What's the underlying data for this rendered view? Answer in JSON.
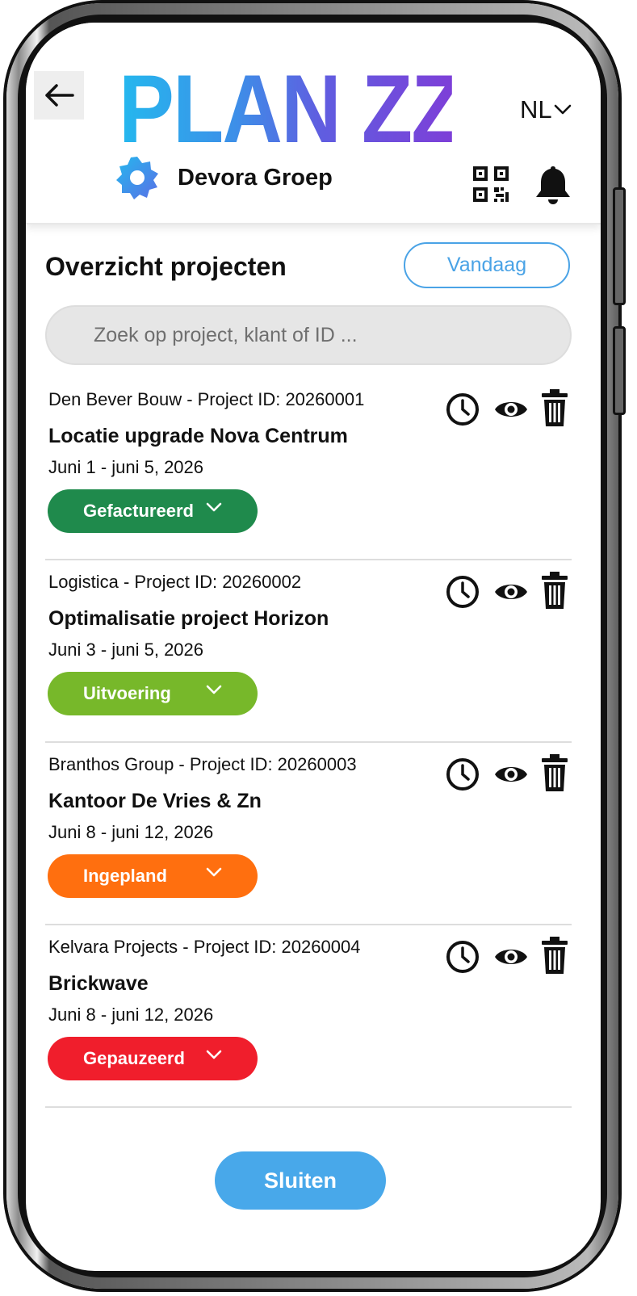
{
  "header": {
    "back_label": "Terug",
    "logo_text": "PLAN ZZP",
    "language": "NL",
    "company_name": "Devora Groep"
  },
  "overview": {
    "title": "Overzicht projecten",
    "today_button": "Vandaag",
    "search_placeholder": "Zoek op project, klant of ID ..."
  },
  "projects": [
    {
      "client_line": "Den Bever Bouw - Project ID: 20260001",
      "title": "Locatie upgrade Nova Centrum",
      "dates": "Juni 1 - juni 5, 2026",
      "status": "Gefactureerd",
      "status_color": "#1f8a4c"
    },
    {
      "client_line": "Logistica - Project ID: 20260002",
      "title": "Optimalisatie project Horizon",
      "dates": "Juni 3 - juni 5, 2026",
      "status": "Uitvoering",
      "status_color": "#77b82a"
    },
    {
      "client_line": "Branthos Group - Project ID: 20260003",
      "title": "Kantoor De Vries & Zn",
      "dates": "Juni 8 - juni 12, 2026",
      "status": "Ingepland",
      "status_color": "#ff6f0f"
    },
    {
      "client_line": "Kelvara Projects - Project ID: 20260004",
      "title": "Brickwave",
      "dates": "Juni 8 - juni 12, 2026",
      "status": "Gepauzeerd",
      "status_color": "#f01e2c"
    }
  ],
  "icons": {
    "back": "arrow-left-icon",
    "language_dropdown": "chevron-down-icon",
    "company": "gear-icon",
    "qr": "qr-code-icon",
    "notifications": "bell-icon",
    "row_actions": [
      "clock-icon",
      "eye-icon",
      "trash-icon"
    ]
  },
  "footer": {
    "close_button": "Sluiten"
  },
  "colors": {
    "accent": "#4aa3e6",
    "close_button": "#48a8ea",
    "logo_gradient_start": "#24b8ee",
    "logo_gradient_end": "#7d3fd8"
  }
}
